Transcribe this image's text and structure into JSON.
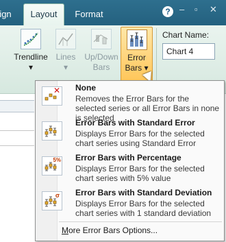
{
  "tabs": {
    "design": "ign",
    "layout": "Layout",
    "format": "Format"
  },
  "window": {
    "help": "?",
    "minimize": "–",
    "restore": "▫",
    "close": "✕"
  },
  "ribbon": {
    "trendline": "Trendline",
    "lines": "Lines",
    "updown_line1": "Up/Down",
    "updown_line2": "Bars",
    "errorbars_line1": "Error",
    "errorbars_line2": "Bars",
    "dropdown_arrow": "▾",
    "chart_name_label": "Chart Name:",
    "chart_name_value": "Chart 4"
  },
  "menu": {
    "items": [
      {
        "title": "None",
        "description": "Removes the Error Bars for the selected series or all Error Bars in none is selected",
        "icon": "error-bars-none-icon"
      },
      {
        "title": "Error Bars with Standard Error",
        "description": "Displays Error Bars for the selected chart series using Standard Error",
        "icon": "error-bars-standard-error-icon"
      },
      {
        "title": "Error Bars with Percentage",
        "description": "Displays Error Bars for the selected chart series with 5% value",
        "icon": "error-bars-percentage-icon",
        "badge": "5%"
      },
      {
        "title": "Error Bars with Standard Deviation",
        "description": "Displays Error Bars for the selected chart series with 1 standard deviation",
        "icon": "error-bars-standard-deviation-icon",
        "badge": "σ"
      }
    ],
    "more_first": "M",
    "more_rest": "ore Error Bars Options..."
  },
  "colors": {
    "tab_strip": "#2e6f8e",
    "ribbon_bg": "#eaf4ef",
    "selected_button": "#ffc65a"
  }
}
